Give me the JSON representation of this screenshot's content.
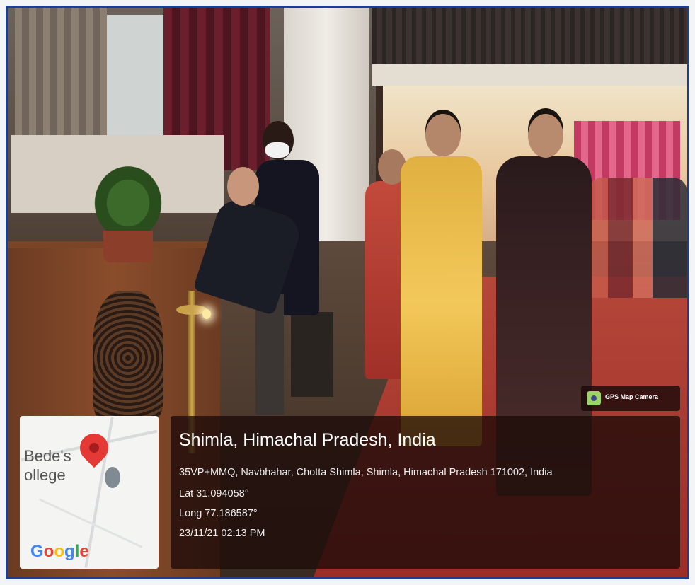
{
  "map": {
    "label_line1": "Bede's",
    "label_line2": "ollege",
    "google": {
      "letters": [
        "G",
        "o",
        "o",
        "g",
        "l",
        "e"
      ],
      "colors": [
        "#4285F4",
        "#EA4335",
        "#FBBC05",
        "#4285F4",
        "#34A853",
        "#EA4335"
      ]
    },
    "pin_color": "#E53935"
  },
  "location": {
    "place": "Shimla, Himachal Pradesh, India",
    "address": "35VP+MMQ, Navbhahar, Chotta Shimla, Shimla, Himachal Pradesh 171002, India",
    "latitude": "Lat 31.094058°",
    "longitude": "Long 77.186587°",
    "timestamp": "23/11/21 02:13 PM"
  },
  "badge": {
    "label": "GPS Map Camera",
    "icon": "gps-map-camera-icon"
  },
  "colors": {
    "frame": "#1C3F88",
    "panel": "rgba(28,10,8,0.78)",
    "carpet": "#9A2E27"
  }
}
